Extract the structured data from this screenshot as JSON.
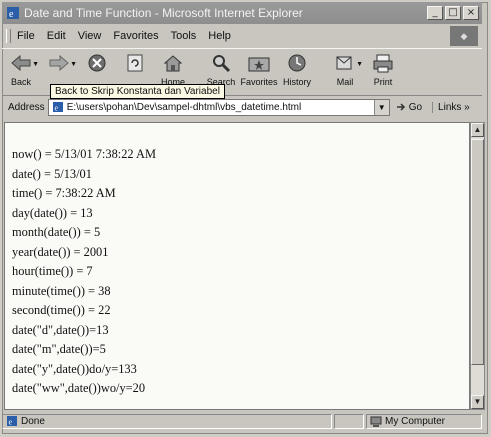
{
  "window": {
    "title": "Date and Time Function - Microsoft Internet Explorer"
  },
  "menubar": {
    "items": [
      "File",
      "Edit",
      "View",
      "Favorites",
      "Tools",
      "Help"
    ]
  },
  "toolbar": {
    "back_label": "Back",
    "home_label": "Home",
    "search_label": "Search",
    "favorites_label": "Favorites",
    "history_label": "History",
    "mail_label": "Mail",
    "print_label": "Print",
    "tooltip": "Back to Skrip Konstanta dan Variabel"
  },
  "addressbar": {
    "label": "Address",
    "url": "E:\\users\\pohan\\Dev\\sampel-dhtml\\vbs_datetime.html",
    "go_label": "Go",
    "links_label": "Links"
  },
  "content": {
    "lines": [
      "now() = 5/13/01 7:38:22 AM",
      "date() = 5/13/01",
      "time() = 7:38:22 AM",
      "day(date()) = 13",
      "month(date()) = 5",
      "year(date()) = 2001",
      "hour(time()) = 7",
      "minute(time()) = 38",
      "second(time()) = 22",
      "date(\"d\",date())=13",
      "date(\"m\",date())=5",
      "date(\"y\",date())do/y=133",
      "date(\"ww\",date())wo/y=20"
    ]
  },
  "statusbar": {
    "status": "Done",
    "zone": "My Computer"
  }
}
